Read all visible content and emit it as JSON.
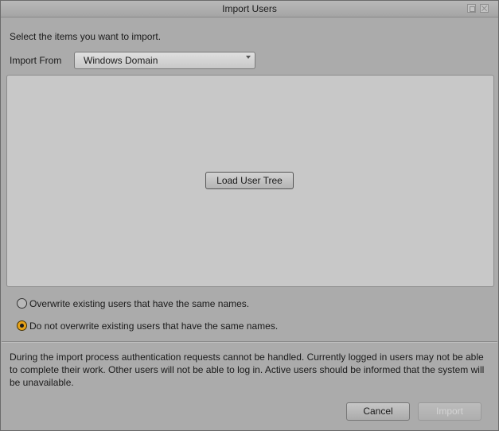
{
  "window": {
    "title": "Import Users"
  },
  "instruction": "Select the items you want to import.",
  "import_from": {
    "label": "Import From",
    "selected": "Windows Domain"
  },
  "tree_panel": {
    "load_button": "Load User Tree"
  },
  "options": [
    {
      "label": "Overwrite existing users that have the same names.",
      "selected": false
    },
    {
      "label": "Do not overwrite existing users that have the same names.",
      "selected": true
    }
  ],
  "warning": "During the import process authentication requests cannot be handled. Currently logged in users may not be able to complete their work. Other users will not be able to log in. Active users should be informed that the system will be unavailable.",
  "footer": {
    "cancel_label": "Cancel",
    "import_label": "Import",
    "import_enabled": false
  },
  "colors": {
    "accent": "#e5a21a",
    "background": "#ababab",
    "panel": "#c8c8c8"
  }
}
